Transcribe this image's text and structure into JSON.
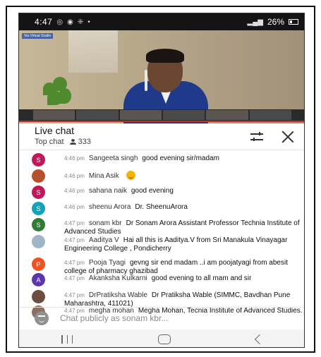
{
  "status_bar": {
    "time": "4:47",
    "notif_icons": [
      "whatsapp-icon",
      "chrome-icon",
      "wifi-signal-icon",
      "dot-icon"
    ],
    "right_text": "26%"
  },
  "video": {
    "watermark": "Via Virtual Studio"
  },
  "chat": {
    "title": "Live chat",
    "mode": "Top chat",
    "viewer_count": "333",
    "input_placeholder": "Chat publicly as sonam kbr..."
  },
  "messages": [
    {
      "avatar": "S",
      "color": "#c2185b",
      "time": "4:46 pm",
      "author": "Sangeeta singh",
      "text": "good evening sir/madam"
    },
    {
      "avatar": "",
      "color": "#b5522d",
      "time": "4:46 pm",
      "author": "Mina Asik",
      "text": "",
      "emoji": true
    },
    {
      "avatar": "S",
      "color": "#c2185b",
      "time": "4:46 pm",
      "author": "sahana naik",
      "text": "good evening"
    },
    {
      "avatar": "S",
      "color": "#12a3b8",
      "time": "4:46 pm",
      "author": "sheenu Arora",
      "text": "Dr. SheenuArora"
    },
    {
      "avatar": "S",
      "color": "#2e7d32",
      "time": "4:47 pm",
      "author": "sonam kbr",
      "text": "Dr Sonam Arora Assistant Professor Technia Institute of Advanced Studies"
    },
    {
      "avatar": "",
      "color": "#9fb6c9",
      "time": "4:47 pm",
      "author": "Aaditya V",
      "text": "Hai all this is Aaditya.V from Sri Manakula Vinayagar Engineering College , Pondicherry"
    },
    {
      "avatar": "P",
      "color": "#f4511e",
      "time": "4:47 pm",
      "author": "Pooja Tyagi",
      "text": "gevng sir end madam ..i am poojatyagi from abesit college of pharmacy ghazibad"
    },
    {
      "avatar": "A",
      "color": "#5e35b1",
      "time": "4:47 pm",
      "author": "Akanksha Kulkarni",
      "text": "good evening to all mam and sir"
    },
    {
      "avatar": "",
      "color": "#6d4c41",
      "time": "4:47 pm",
      "author": "DrPratiksha Wable",
      "text": "Dr Pratiksha Wable (SIMMC, Bavdhan Pune Maharashtra, 411021)"
    },
    {
      "avatar": "",
      "color": "#8d6e63",
      "time": "4:47 pm",
      "author": "megha mohan",
      "text": "Megha Mohan, Tecnia Institute of Advanced Studies."
    }
  ]
}
